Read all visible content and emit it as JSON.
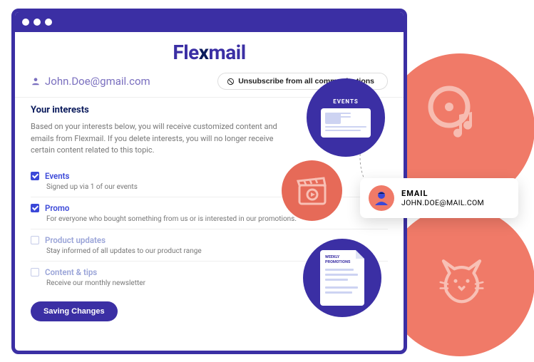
{
  "logo": {
    "part1": "Fle",
    "x": "x",
    "part2": "mail"
  },
  "user_email": "John.Doe@gmail.com",
  "unsubscribe_label": "Unsubscribe from all communications",
  "section": {
    "title": "Your interests",
    "description": "Based on your interests below, you will receive customized content and emails from Flexmail. If you delete interests, you will no longer receive certain content related to this topic."
  },
  "interests": [
    {
      "label": "Events",
      "desc": "Signed up via 1 of our events",
      "checked": true
    },
    {
      "label": "Promo",
      "desc": "For everyone who bought something from us or is interested in our promotions.",
      "checked": true
    },
    {
      "label": "Product updates",
      "desc": "Stay informed of all updates to our product range",
      "checked": false
    },
    {
      "label": "Content & tips",
      "desc": "Receive our monthly newsletter",
      "checked": false
    }
  ],
  "save_label": "Saving Changes",
  "side": {
    "events_tag": "EVENTS",
    "weekly_tag": "WEEKLY PROMOTIONS",
    "email_label": "EMAIL",
    "email_value": "JOHN.DOE@MAIL.COM"
  }
}
